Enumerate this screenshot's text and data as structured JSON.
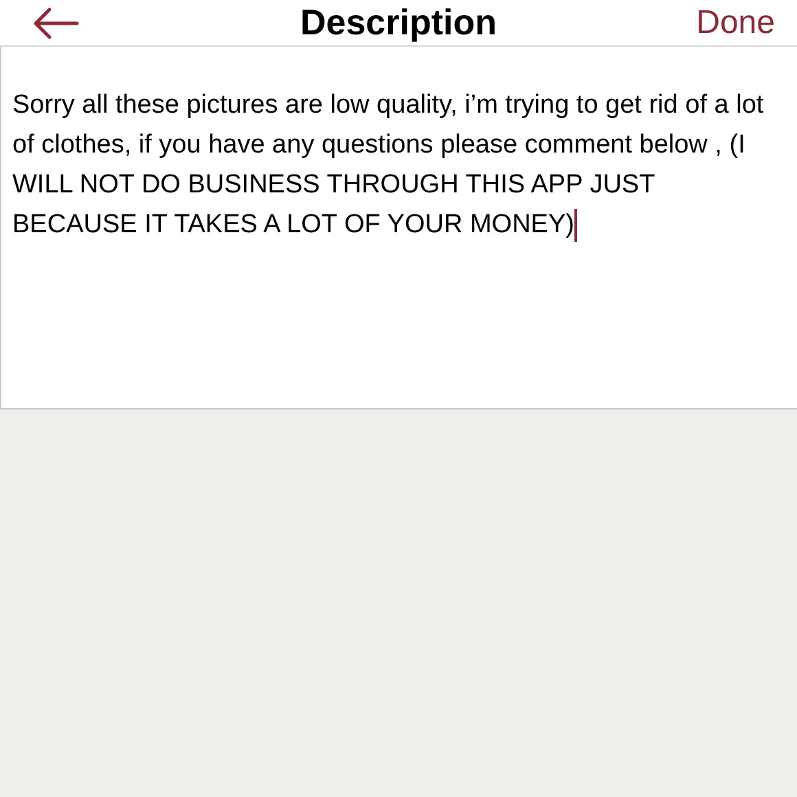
{
  "header": {
    "title": "Description",
    "action": "Done"
  },
  "description": {
    "value": "Sorry all these pictures are low quality, i’m trying to get rid of a lot of clothes, if you have any questions please comment below , (I WILL NOT DO BUSINESS THROUGH THIS APP JUST BECAUSE IT TAKES A LOT OF YOUR MONEY)"
  }
}
